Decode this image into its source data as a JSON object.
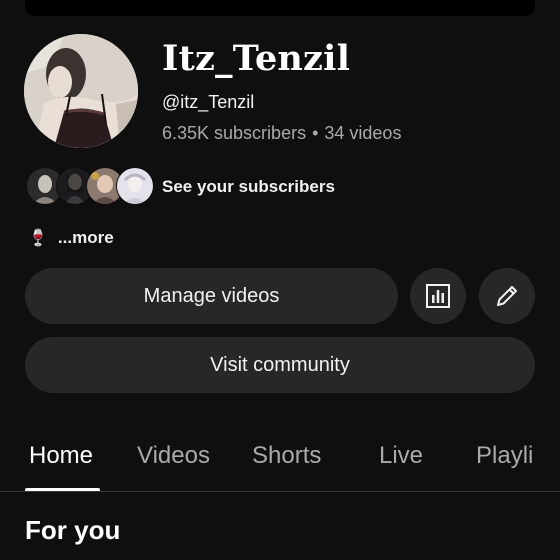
{
  "channel": {
    "name": "Itz_Tenzil",
    "handle": "@itz_Tenzil",
    "subscribers": "6.35K subscribers",
    "separator": "•",
    "videos": "34 videos"
  },
  "subscribers_row": {
    "label": "See your subscribers"
  },
  "description": {
    "emoji": "🍷",
    "more_label": "...more"
  },
  "buttons": {
    "manage_videos": "Manage videos",
    "visit_community": "Visit community",
    "stats_icon": "analytics-icon",
    "edit_icon": "pencil-icon"
  },
  "tabs": [
    {
      "label": "Home",
      "active": true
    },
    {
      "label": "Videos",
      "active": false
    },
    {
      "label": "Shorts",
      "active": false
    },
    {
      "label": "Live",
      "active": false
    },
    {
      "label": "Playli",
      "active": false
    }
  ],
  "section": {
    "title": "For you"
  },
  "colors": {
    "background": "#0f0f0f",
    "button": "#272727",
    "text_primary": "#f1f1f1",
    "text_secondary": "#aaaaaa"
  }
}
